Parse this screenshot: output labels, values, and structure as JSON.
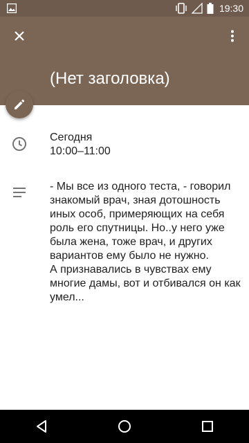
{
  "status_bar": {
    "time": "19:30",
    "icons": [
      "image-notification-icon",
      "vibrate-icon",
      "signal-icon",
      "battery-icon"
    ]
  },
  "header": {
    "title": "(Нет заголовка)",
    "color": "#7b6656",
    "close_icon": "close-icon",
    "menu_icon": "more-vert-icon"
  },
  "edit_button": {
    "icon": "pencil-icon"
  },
  "event": {
    "day": "Сегодня",
    "time_range": "10:00–11:00",
    "description": "- Мы все из одного теста, - говорил знакомый врач, зная дотошность иных особ, примеряющих на себя роль его спутницы. Но..у него уже была жена, тоже врач, и других вариантов ему было не нужно.\nА признавались в чувствах ему многие дамы, вот и отбивался он как умел..."
  },
  "nav_bar": {
    "icons": [
      "back-icon",
      "home-icon",
      "recents-icon"
    ]
  }
}
